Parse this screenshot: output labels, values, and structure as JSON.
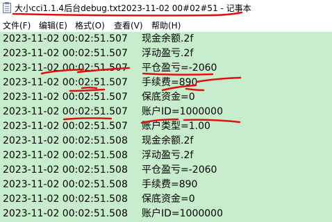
{
  "window": {
    "title": "大小cci1.1.4后台debug.txt2023-11-02 00#02#51 - 记事本",
    "icon": "notepad-icon"
  },
  "menu": [
    {
      "label": "文件(F)"
    },
    {
      "label": "编辑(E)"
    },
    {
      "label": "格式(O)"
    },
    {
      "label": "查看(V)"
    },
    {
      "label": "帮助(H)"
    }
  ],
  "lines": [
    {
      "timestamp": "2023-11-02 00:02:51.507",
      "text": "现金余额.2f"
    },
    {
      "timestamp": "2023-11-02 00:02:51.507",
      "text": "浮动盈亏.2f"
    },
    {
      "timestamp": "2023-11-02 00:02:51.507",
      "text": "平仓盈亏=-2060"
    },
    {
      "timestamp": "2023-11-02 00:02:51.507",
      "text": "手续费=890"
    },
    {
      "timestamp": "2023-11-02 00:02:51.507",
      "text": "保底资金=0"
    },
    {
      "timestamp": "2023-11-02 00:02:51.507",
      "text": "账户ID=1000000"
    },
    {
      "timestamp": "2023-11-02 00:02:51.507",
      "text": "账户类型=1.00"
    },
    {
      "timestamp": "2023-11-02 00:02:51.508",
      "text": "现金余额.2f"
    },
    {
      "timestamp": "2023-11-02 00:02:51.508",
      "text": "浮动盈亏.2f"
    },
    {
      "timestamp": "2023-11-02 00:02:51.508",
      "text": "平仓盈亏=-2060"
    },
    {
      "timestamp": "2023-11-02 00:02:51.508",
      "text": "手续费=890"
    },
    {
      "timestamp": "2023-11-02 00:02:51.508",
      "text": "保底资金=0"
    },
    {
      "timestamp": "2023-11-02 00:02:51.508",
      "text": "账户ID=1000000"
    }
  ],
  "colors": {
    "editor_background": "#c7edcc",
    "annotation_stroke": "#e01010"
  }
}
